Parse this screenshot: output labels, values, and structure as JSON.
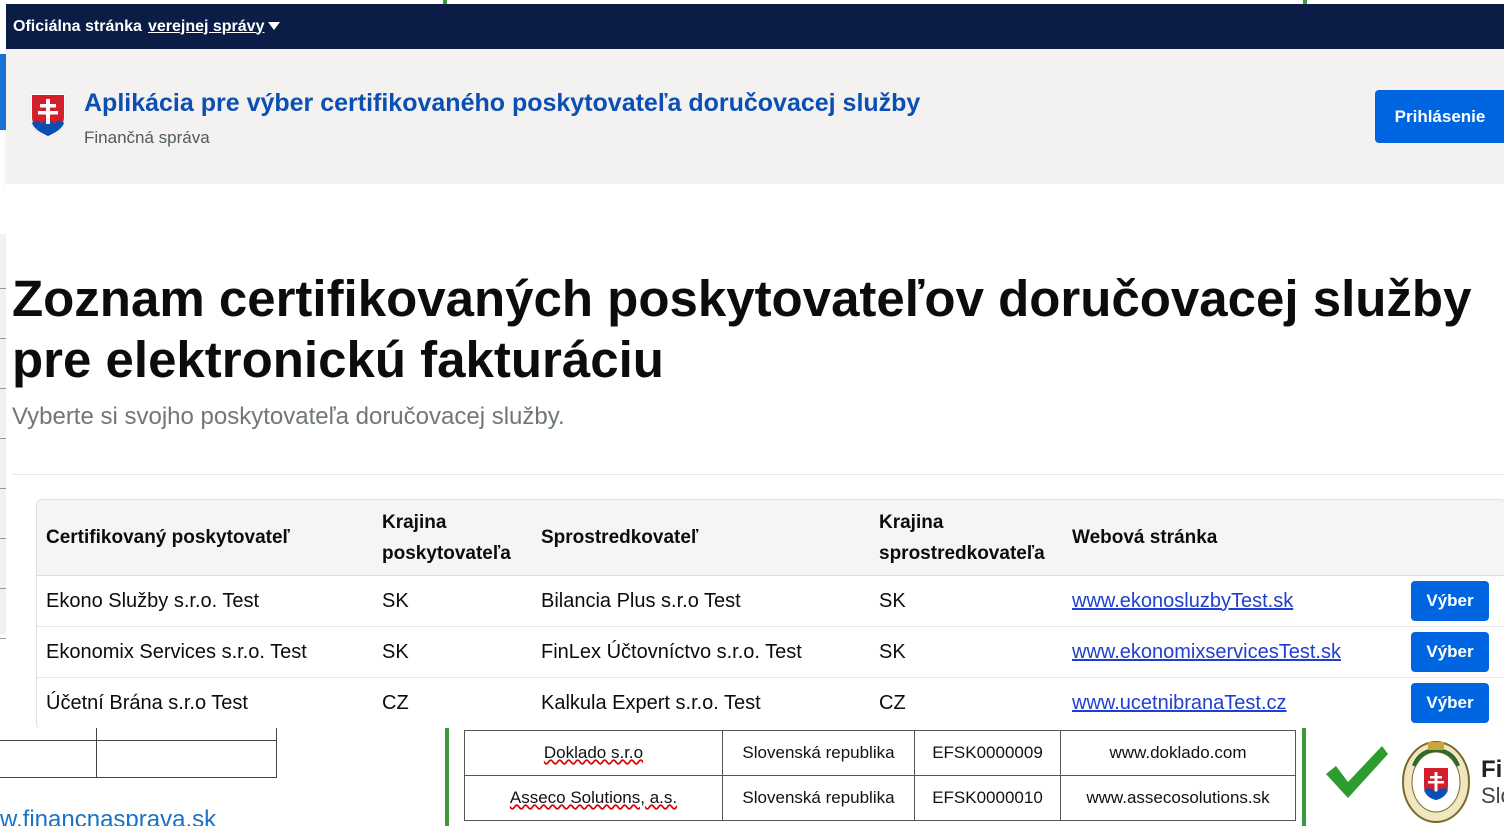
{
  "gov_bar": {
    "prefix": "Oficiálna stránka",
    "link": "verejnej správy"
  },
  "header": {
    "app_title": "Aplikácia pre výber certifikovaného poskytovateľa doručovacej služby",
    "app_subtitle": "Finančná správa",
    "login_label": "Prihlásenie"
  },
  "main": {
    "title": "Zoznam certifikovaných poskytovateľov doručovacej služby pre elektronickú fakturáciu",
    "lead": "Vyberte si svojho poskytovateľa doručovacej služby."
  },
  "table": {
    "headers": {
      "provider": "Certifikovaný poskytovateľ",
      "provider_country": "Krajina poskytovateľa",
      "intermediary": "Sprostredkovateľ",
      "intermediary_country": "Krajina sprostredkovateľa",
      "website": "Webová stránka"
    },
    "rows": [
      {
        "provider": "Ekono Služby s.r.o. Test",
        "provider_country": "SK",
        "intermediary": "Bilancia Plus s.r.o Test",
        "intermediary_country": "SK",
        "website": "www.ekonosluzbyTest.sk",
        "action": "Výber"
      },
      {
        "provider": "Ekonomix Services s.r.o. Test",
        "provider_country": "SK",
        "intermediary": "FinLex Účtovníctvo s.r.o. Test",
        "intermediary_country": "SK",
        "website": "www.ekonomixservicesTest.sk",
        "action": "Výber"
      },
      {
        "provider": "Účetní Brána s.r.o Test",
        "provider_country": "CZ",
        "intermediary": "Kalkula Expert s.r.o. Test",
        "intermediary_country": "CZ",
        "website": "www.ucetnibranaTest.cz",
        "action": "Výber"
      }
    ]
  },
  "slide": {
    "left_url": "w.financnasprava.sk",
    "registry_rows": [
      {
        "name": "Doklado s.r.o",
        "country": "Slovenská republika",
        "id": "EFSK0000009",
        "web": "www.doklado.com"
      },
      {
        "name": "Asseco Solutions, a.s.",
        "country": "Slovenská republika",
        "id": "EFSK0000010",
        "web": "www.assecosolutions.sk"
      }
    ],
    "brand_line_1": "Fi",
    "brand_line_2": "Slo"
  },
  "colors": {
    "gov_bar": "#0b1c47",
    "primary": "#0065e0",
    "title_blue": "#0b4fb3",
    "link": "#1f3fd0",
    "slide_green": "#3a9a3a"
  }
}
